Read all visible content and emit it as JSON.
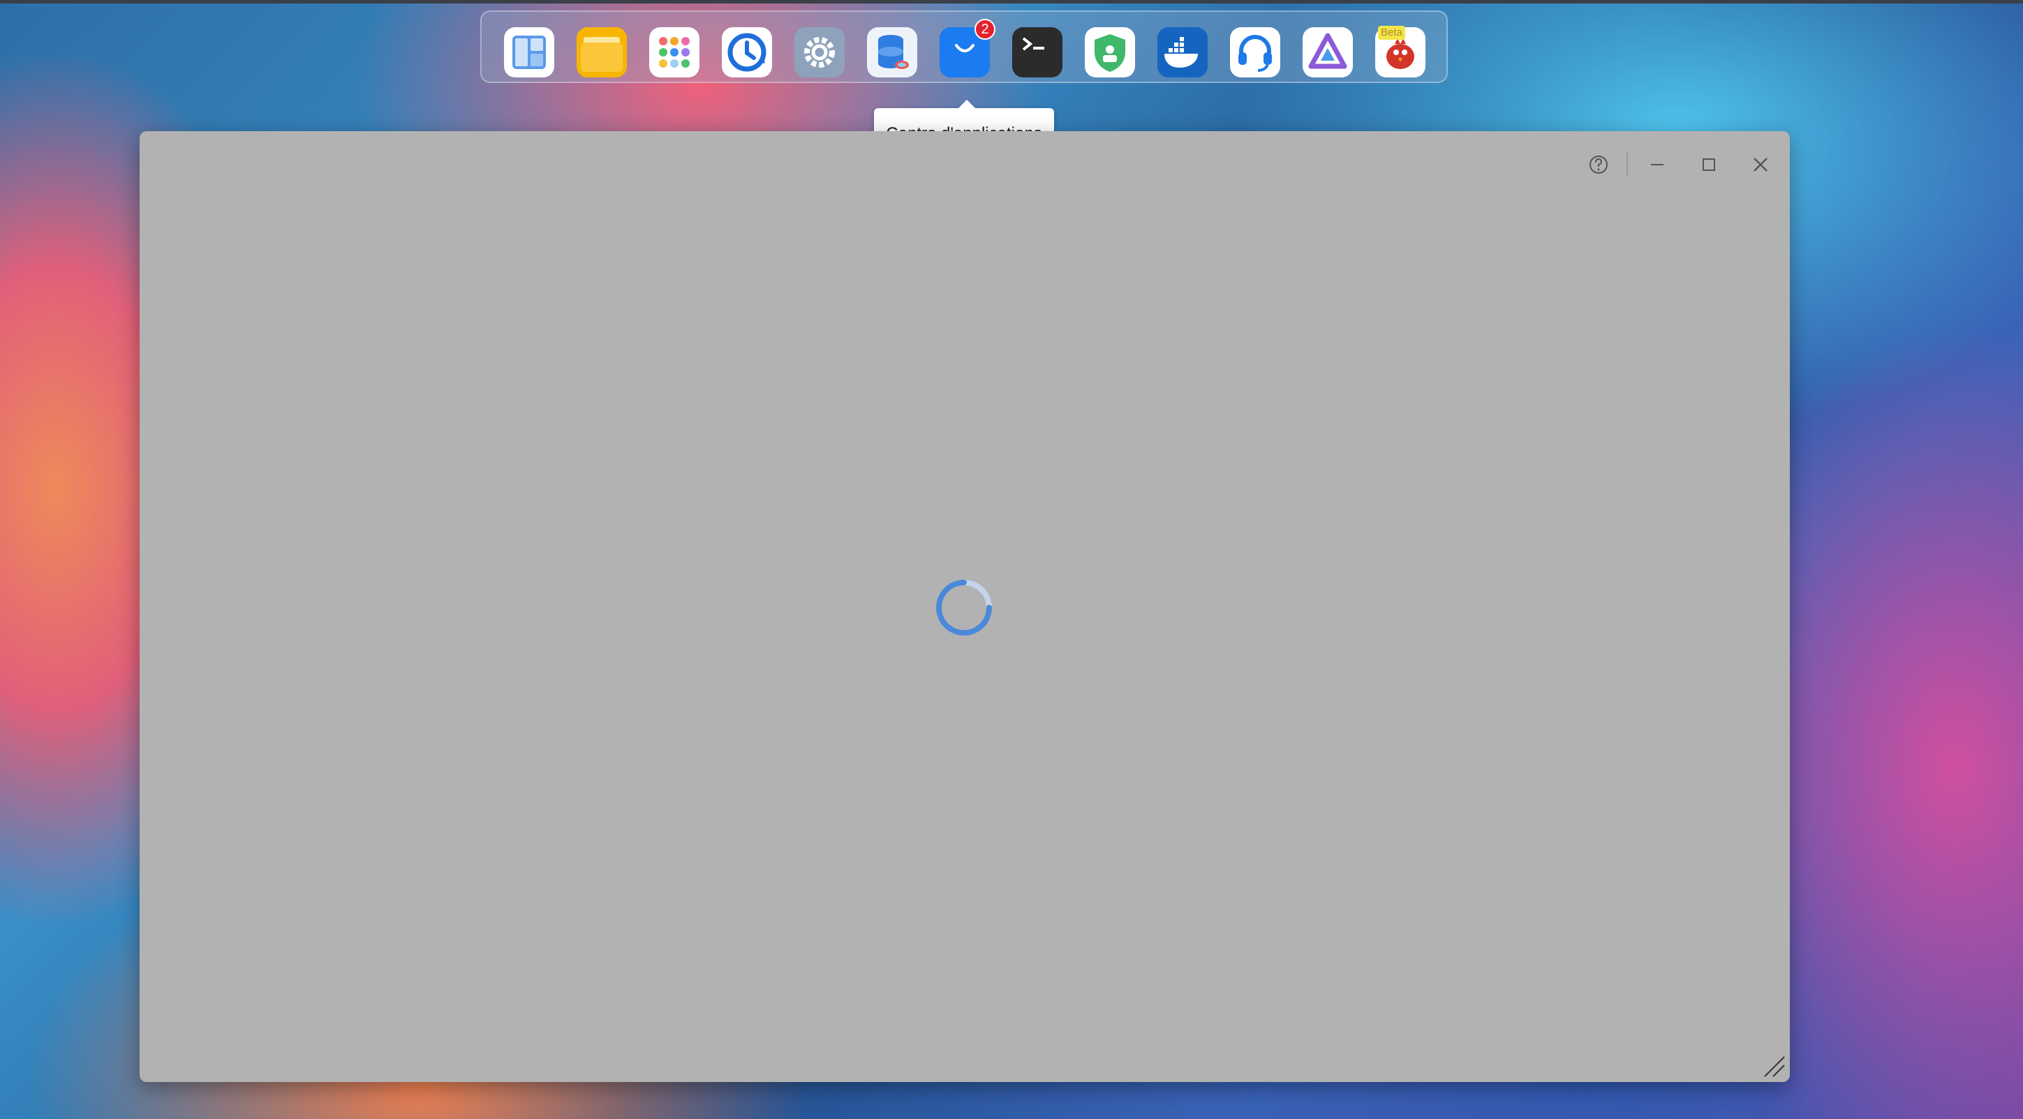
{
  "dock": {
    "items": [
      {
        "name": "dashboard-app-icon",
        "color": "#4a90e2"
      },
      {
        "name": "file-manager-app-icon",
        "color": "#f5b400"
      },
      {
        "name": "app-launcher-icon",
        "color": "#ffffff"
      },
      {
        "name": "backup-clock-app-icon",
        "color": "#1e6fd9"
      },
      {
        "name": "settings-gear-app-icon",
        "color": "#8aa0b8"
      },
      {
        "name": "storage-manager-app-icon",
        "color": "#e8eef5"
      },
      {
        "name": "app-center-bag-icon",
        "color": "#1a7cf0",
        "badge": "2"
      },
      {
        "name": "terminal-app-icon",
        "color": "#2b2b2b"
      },
      {
        "name": "security-shield-app-icon",
        "color": "#3fb86a"
      },
      {
        "name": "docker-app-icon",
        "color": "#1565c0"
      },
      {
        "name": "support-headset-app-icon",
        "color": "#ffffff"
      },
      {
        "name": "jellyfin-app-icon",
        "color": "#ffffff"
      },
      {
        "name": "bird-app-icon",
        "color": "#ffffff",
        "tag": "Beta"
      }
    ]
  },
  "tooltip": {
    "text": "Centre d'applications"
  },
  "window": {
    "state": "loading"
  }
}
